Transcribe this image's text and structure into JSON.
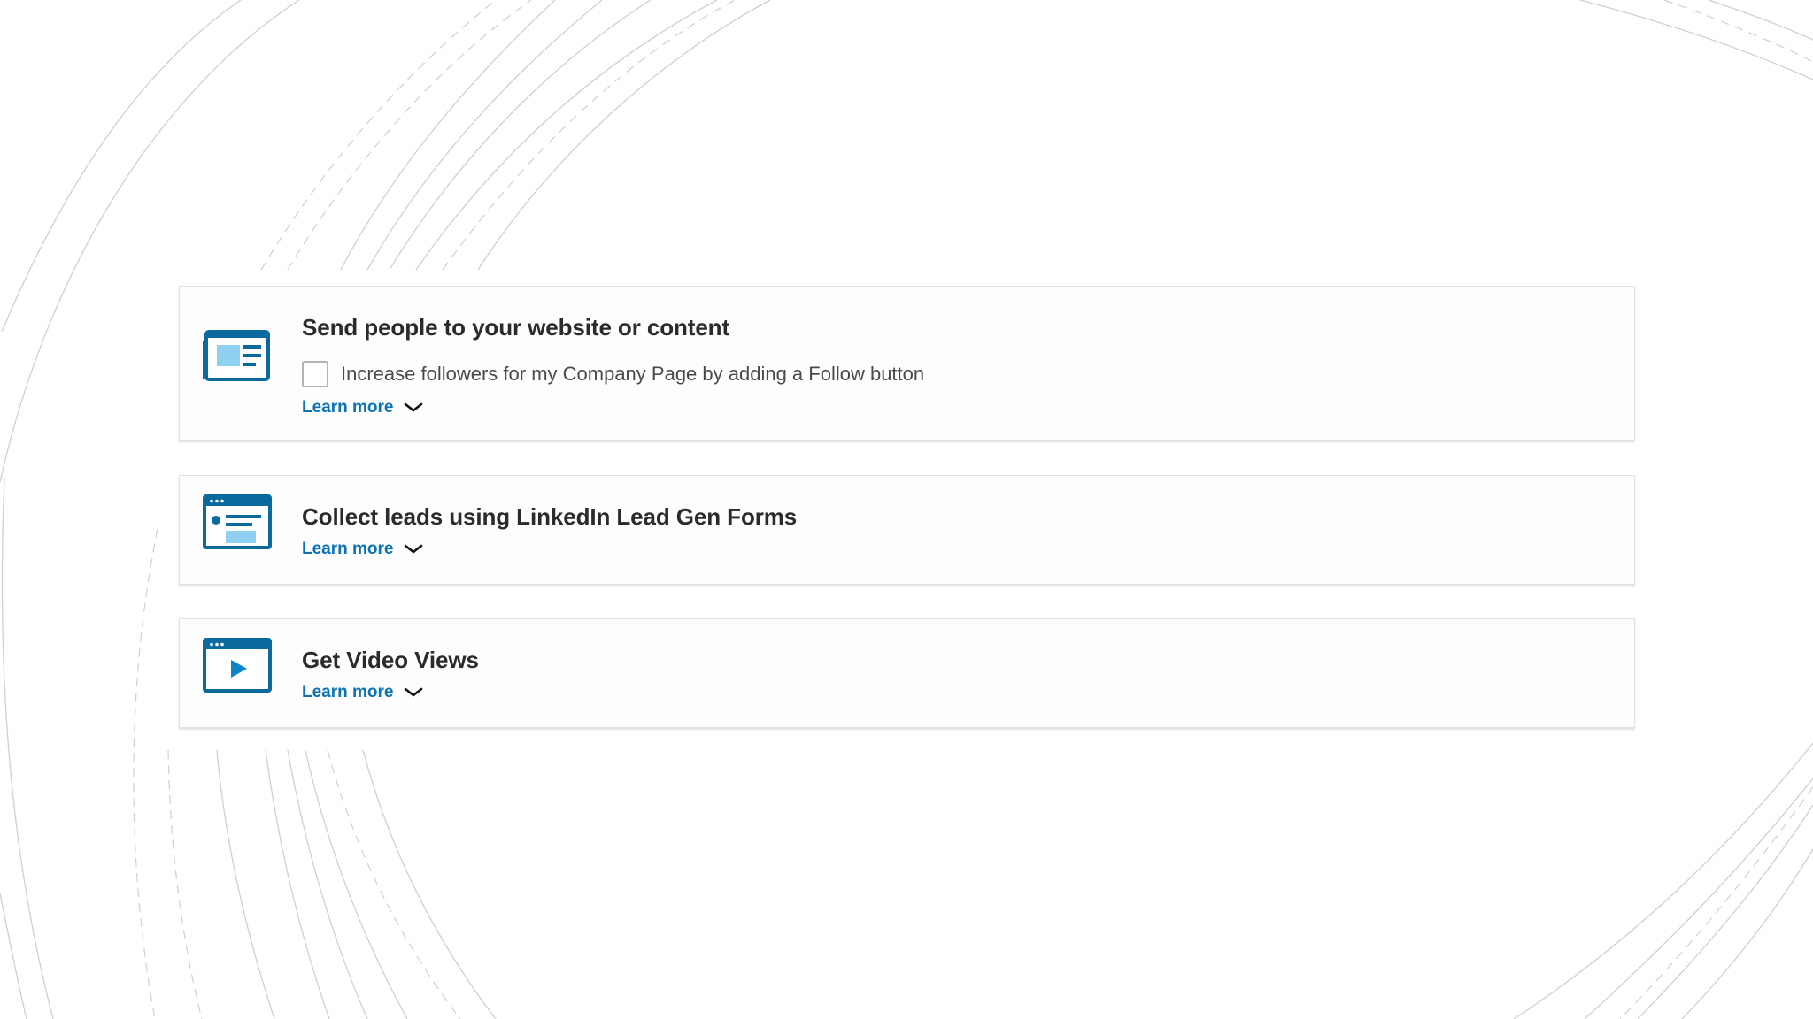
{
  "cards": [
    {
      "title": "Send people to your website or content",
      "option_label": "Increase followers for my Company Page by adding a Follow button",
      "learn_more": "Learn more",
      "icon": "webpage-article-icon"
    },
    {
      "title": "Collect leads using LinkedIn Lead Gen Forms",
      "learn_more": "Learn more",
      "icon": "lead-form-icon"
    },
    {
      "title": "Get Video Views",
      "learn_more": "Learn more",
      "icon": "video-player-icon"
    }
  ],
  "colors": {
    "accent": "#0a73b5",
    "icon_dark": "#0a6a9e",
    "icon_light": "#8fd0f0",
    "title": "#2b2b2b",
    "body_text": "#4a4a4a",
    "card_border": "#e2e2e4",
    "background_lines": "#cfcfd4"
  }
}
